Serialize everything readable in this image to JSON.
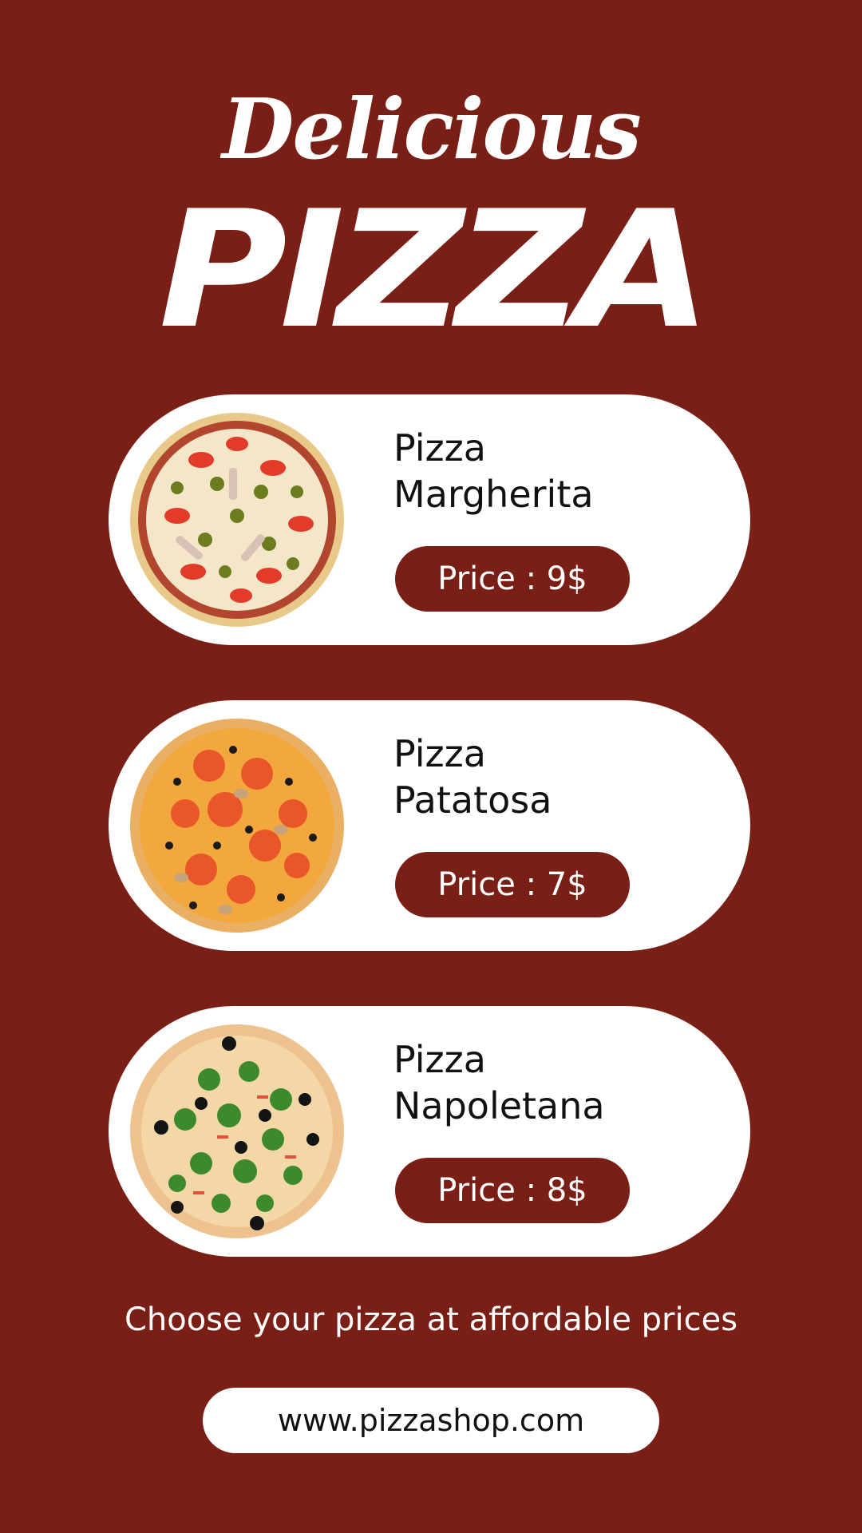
{
  "header": {
    "script_title": "Delicious",
    "main_title": "PIZZA"
  },
  "menu": [
    {
      "name_line1": "Pizza",
      "name_line2": "Margherita",
      "price": "Price : 9$",
      "image": "pizza-margherita-image"
    },
    {
      "name_line1": "Pizza",
      "name_line2": "Patatosa",
      "price": "Price : 7$",
      "image": "pizza-patatosa-image"
    },
    {
      "name_line1": "Pizza",
      "name_line2": "Napoletana",
      "price": "Price : 8$",
      "image": "pizza-napoletana-image"
    }
  ],
  "footer": {
    "tagline": "Choose your pizza at affordable prices",
    "website": "www.pizzashop.com"
  },
  "colors": {
    "background": "#7a1f15",
    "card": "#ffffff",
    "accent": "#7a1f15"
  }
}
